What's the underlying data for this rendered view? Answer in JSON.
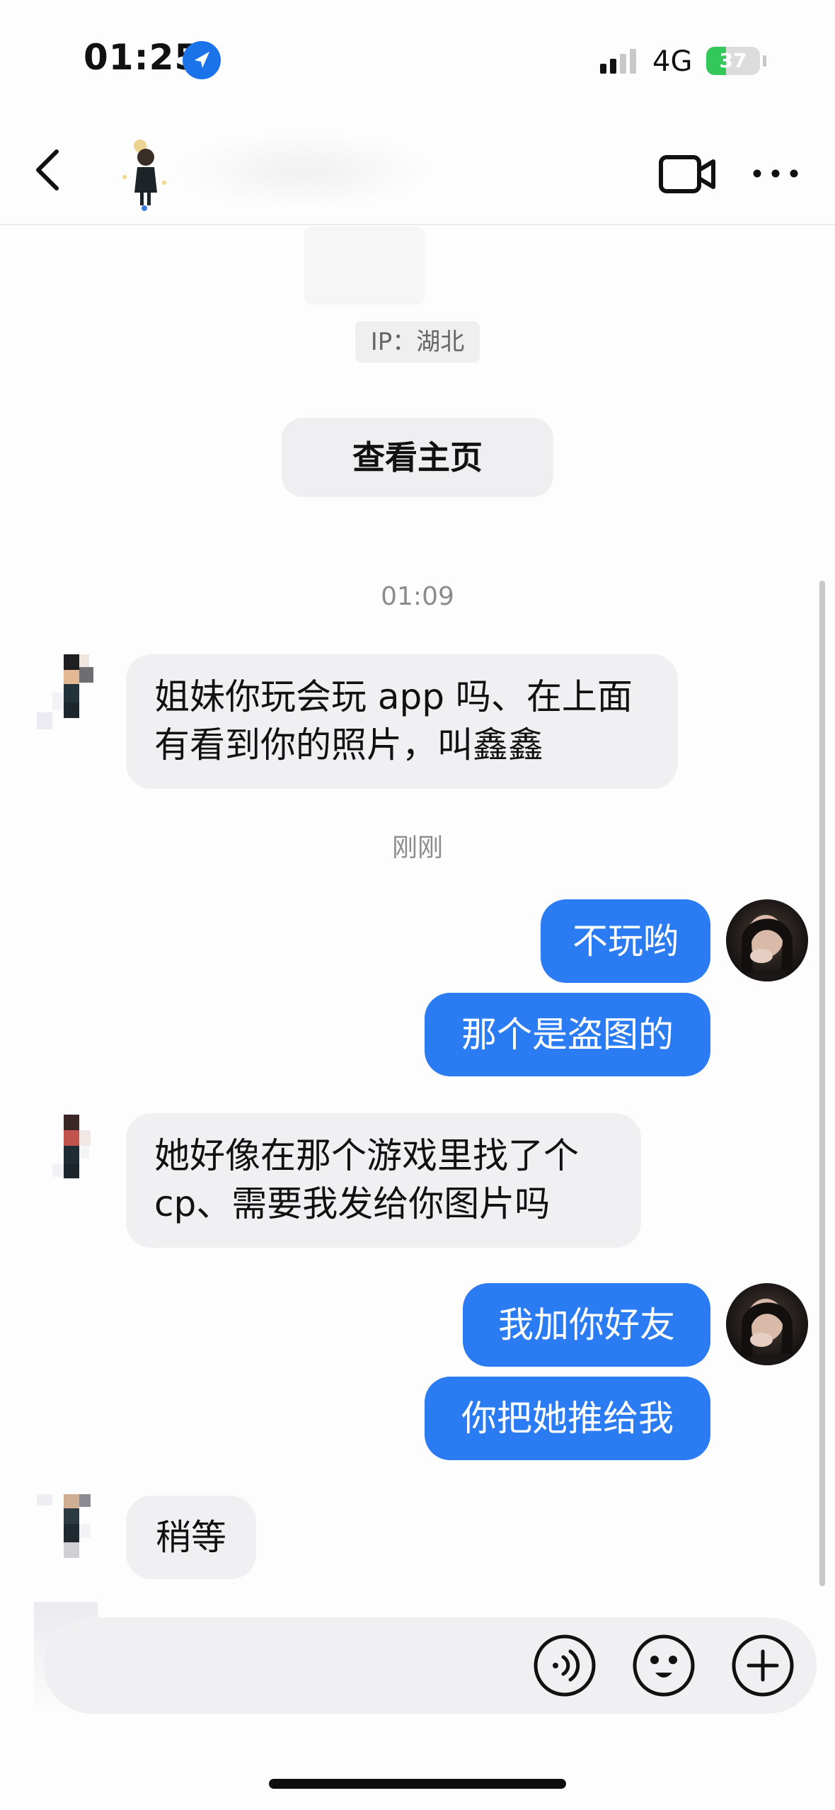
{
  "status_bar": {
    "time": "01:25",
    "network": "4G",
    "battery_level": "37",
    "battery_fraction": 0.37
  },
  "nav": {
    "back_icon": "chevron-left-icon",
    "video_icon": "video-camera-icon",
    "more_icon": "more-dots-icon"
  },
  "header": {
    "ip_label": "IP：湖北",
    "profile_button": "查看主页"
  },
  "timestamps": {
    "first": "01:09",
    "second": "刚刚"
  },
  "messages": [
    {
      "from": "peer",
      "lines": [
        "姐妹你玩会玩 app 吗、在上面",
        "有看到你的照片，叫鑫鑫"
      ]
    },
    {
      "from": "self",
      "text": "不玩哟"
    },
    {
      "from": "self",
      "text": "那个是盗图的"
    },
    {
      "from": "peer",
      "lines": [
        "她好像在那个游戏里找了个",
        "cp、需要我发给你图片吗"
      ]
    },
    {
      "from": "self",
      "text": "我加你好友"
    },
    {
      "from": "self",
      "text": "你把她推给我"
    },
    {
      "from": "peer",
      "lines": [
        "稍等"
      ]
    }
  ],
  "composer": {
    "voice_icon": "voice-icon",
    "emoji_icon": "emoji-icon",
    "plus_icon": "plus-icon"
  },
  "colors": {
    "outgoing_bubble": "#2b7bf2",
    "incoming_bubble": "#f0f0f3",
    "battery": "#34c759",
    "location": "#1a73e8"
  }
}
